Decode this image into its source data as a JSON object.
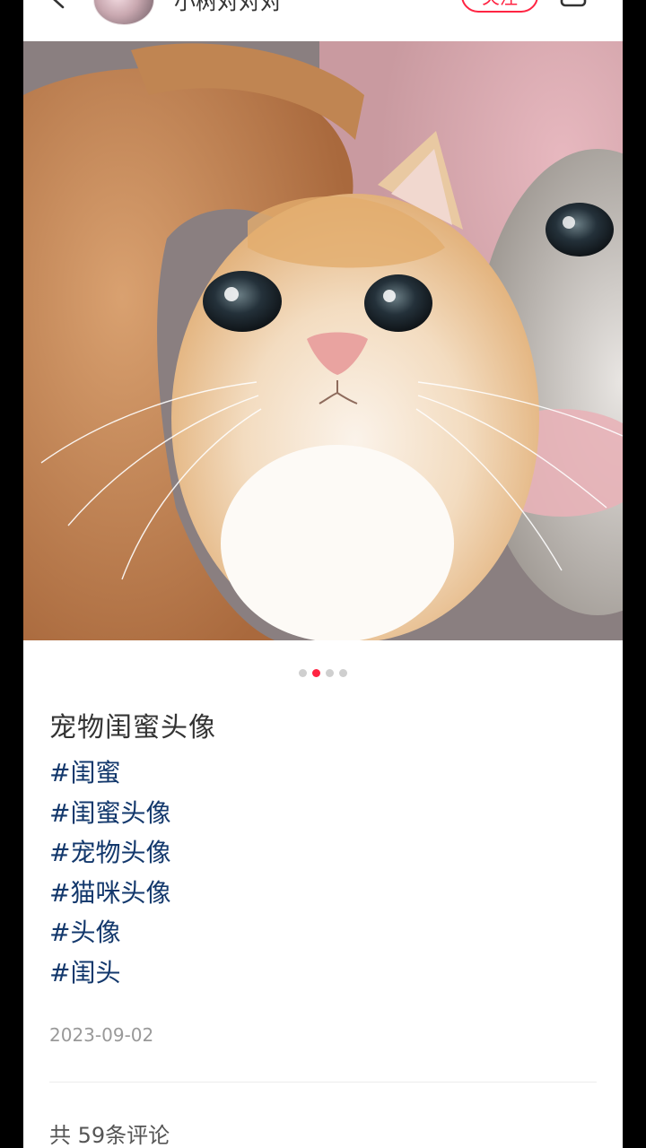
{
  "header": {
    "username": "小树对对对",
    "follow_label": "关注",
    "back_icon": "chevron-left-icon",
    "share_icon": "share-icon"
  },
  "post": {
    "image_description_icon": "cat-photo",
    "carousel": {
      "count": 4,
      "active_index": 1
    },
    "title": "宠物闺蜜头像",
    "tags": [
      "#闺蜜",
      "#闺蜜头像",
      "#宠物头像",
      "#猫咪头像",
      "#头像",
      "#闺头"
    ],
    "date": "2023-09-02"
  },
  "comments": {
    "count_label": "共 59条评论"
  },
  "colors": {
    "accent": "#ff2442",
    "tag": "#13386c",
    "muted": "#999999"
  }
}
